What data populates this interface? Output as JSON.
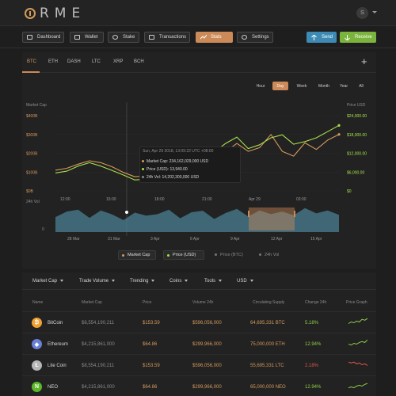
{
  "brand": {
    "name": "RME"
  },
  "user": {
    "initial": "S"
  },
  "nav": {
    "items": [
      {
        "label": "Dashboard",
        "icon": "monitor-icon"
      },
      {
        "label": "Wallet",
        "icon": "wallet-icon"
      },
      {
        "label": "Stake",
        "icon": "stake-icon"
      },
      {
        "label": "Transactions",
        "icon": "transactions-icon"
      },
      {
        "label": "Stats",
        "icon": "stats-icon",
        "active": true
      },
      {
        "label": "Settings",
        "icon": "settings-icon"
      }
    ],
    "send_label": "Send",
    "receive_label": "Receive"
  },
  "coin_tabs": [
    "BTC",
    "ETH",
    "DASH",
    "LTC",
    "XRP",
    "BCH"
  ],
  "active_tab": "BTC",
  "ranges": [
    "Hour",
    "Day",
    "Week",
    "Month",
    "Year",
    "All"
  ],
  "active_range": "Day",
  "colors": {
    "accent": "#cc8a58",
    "market_cap": "#d49a5c",
    "price_usd": "#a8e04a",
    "volume": "#4a7f93",
    "positive": "#8fcc4a",
    "negative": "#e0584a",
    "send": "#3d8bb5",
    "receive": "#7bb43c"
  },
  "chart_data": {
    "type": "line",
    "left_axis_label": "Market Cap",
    "right_axis_label": "Price USD",
    "left_ticks": [
      "$400B",
      "$300B",
      "$200B",
      "$100B",
      "$0B"
    ],
    "right_ticks": [
      "$24,000.00",
      "$18,000.00",
      "$12,000.00",
      "$6,000.00",
      "$0"
    ],
    "x_ticks_top": [
      "12:00",
      "15:00",
      "18:00",
      "21:00",
      "Apr 29",
      "03:00"
    ],
    "volume_label": "24h Vol",
    "volume_zero": "0",
    "x_ticks_bottom": [
      "28 Mar",
      "31 Mar",
      "3 Apr",
      "6 Apr",
      "9 Apr",
      "12 Apr",
      "15 Apr"
    ],
    "x": [
      0,
      0.04,
      0.08,
      0.12,
      0.16,
      0.2,
      0.24,
      0.28,
      0.32,
      0.36,
      0.4,
      0.44,
      0.48,
      0.52,
      0.56,
      0.6,
      0.64,
      0.68,
      0.72,
      0.76,
      0.8,
      0.84,
      0.88,
      0.92,
      0.96,
      1.0
    ],
    "series": [
      {
        "name": "Market Cap",
        "axis": "left",
        "values": [
          110,
          120,
          142,
          160,
          150,
          128,
          98,
          75,
          80,
          140,
          168,
          182,
          198,
          180,
          222,
          208,
          252,
          210,
          230,
          300,
          210,
          185,
          255,
          220,
          270,
          300
        ]
      },
      {
        "name": "Price (USD)",
        "axis": "left",
        "values": [
          95,
          105,
          132,
          150,
          132,
          108,
          84,
          58,
          62,
          118,
          155,
          160,
          132,
          165,
          205,
          252,
          286,
          225,
          245,
          282,
          298,
          248,
          262,
          282,
          315,
          348
        ]
      }
    ],
    "volume": [
      40,
      55,
      60,
      38,
      58,
      47,
      32,
      52,
      44,
      48,
      60,
      37,
      53,
      57,
      35,
      51,
      62,
      42,
      58,
      48,
      55,
      45,
      64,
      50,
      58,
      46
    ],
    "tooltip": {
      "date": "Sun, Apr 29 2018, 13:09:22 UTC +08:00",
      "market_cap": "Market Cap: 234,162,029,000 USD",
      "price": "Price (USD): 13,940.00",
      "volume": "24h Vol: 14,202,300,000 USD"
    },
    "legend": [
      {
        "label": "Market Cap",
        "on": true,
        "color": "#d49a5c"
      },
      {
        "label": "Price (USD)",
        "on": true,
        "color": "#a8e04a"
      },
      {
        "label": "Price (BTC)",
        "on": false,
        "color": "#777"
      },
      {
        "label": "24h Vol",
        "on": false,
        "color": "#777"
      }
    ]
  },
  "table": {
    "filters": [
      "Market Cap",
      "Trade Volume",
      "Trending",
      "Coins",
      "Tools",
      "USD"
    ],
    "headers": [
      "Name",
      "Market Cap",
      "Price",
      "Volume 24h",
      "Circulating Supply",
      "Change 24h",
      "Price Graph"
    ],
    "rows": [
      {
        "name": "BitCoin",
        "icon": "bitcoin-icon",
        "symbol": "₿",
        "icon_color": "#f2a030",
        "market_cap": "$8,554,190,211",
        "price": "$153.59",
        "volume": "$596,056,000",
        "supply": "64,695,331 BTC",
        "change": "5.18%",
        "trend": "up",
        "spark": [
          4,
          6,
          5,
          7,
          6,
          9,
          8,
          10
        ]
      },
      {
        "name": "Ethereum",
        "icon": "ethereum-icon",
        "symbol": "◆",
        "icon_color": "#6b7fd8",
        "market_cap": "$4,215,861,000",
        "price": "$64.86",
        "volume": "$299,966,000",
        "supply": "75,000,000 ETH",
        "change": "12.94%",
        "trend": "up",
        "spark": [
          5,
          4,
          6,
          5,
          7,
          8,
          7,
          10
        ]
      },
      {
        "name": "Lite Coin",
        "icon": "litecoin-icon",
        "symbol": "Ł",
        "icon_color": "#b5b5b5",
        "market_cap": "$8,554,190,211",
        "price": "$153.59",
        "volume": "$596,056,000",
        "supply": "55,695,331 LTC",
        "change": "2.18%",
        "trend": "down",
        "spark": [
          9,
          8,
          9,
          7,
          8,
          6,
          7,
          5
        ]
      },
      {
        "name": "NEO",
        "icon": "neo-icon",
        "symbol": "N",
        "icon_color": "#5cb82a",
        "market_cap": "$4,215,861,000",
        "price": "$64.86",
        "volume": "$299,966,000",
        "supply": "65,000,000 NEO",
        "change": "12.94%",
        "trend": "up",
        "spark": [
          4,
          5,
          4,
          6,
          7,
          6,
          8,
          9
        ]
      }
    ]
  }
}
